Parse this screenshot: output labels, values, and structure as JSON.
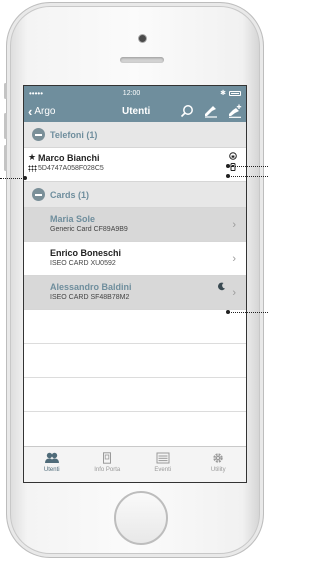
{
  "status_bar": {
    "signal": "•••••",
    "time": "12:00",
    "bluetooth": "✱"
  },
  "navbar": {
    "back_label": "Argo",
    "title": "Utenti",
    "icons": [
      "search-icon",
      "key-icon",
      "add-key-icon"
    ]
  },
  "sections": [
    {
      "title": "Telefoni (1)",
      "rows": [
        {
          "name": "Marco Bianchi",
          "sub": "5D4747A058F028C5"
        }
      ]
    },
    {
      "title": "Cards (1)",
      "rows": [
        {
          "name": "Maria Sole",
          "sub": "Generic Card CF89A9B9"
        },
        {
          "name": "Enrico Boneschi",
          "sub": "ISEO CARD XU0592"
        },
        {
          "name": "Alessandro Baldini",
          "sub": "ISEO CARD SF48B78M2"
        }
      ]
    }
  ],
  "tabbar": {
    "tabs": [
      {
        "label": "Utenti",
        "icon": "users-icon",
        "active": true
      },
      {
        "label": "Info Porta",
        "icon": "door-info-icon",
        "active": false
      },
      {
        "label": "Eventi",
        "icon": "events-list-icon",
        "active": false
      },
      {
        "label": "Utility",
        "icon": "gear-icon",
        "active": false
      }
    ]
  },
  "colors": {
    "accent": "#6f8e9d",
    "section_bg": "#e7e7e7",
    "highlight_row": "#d8d8d8"
  }
}
